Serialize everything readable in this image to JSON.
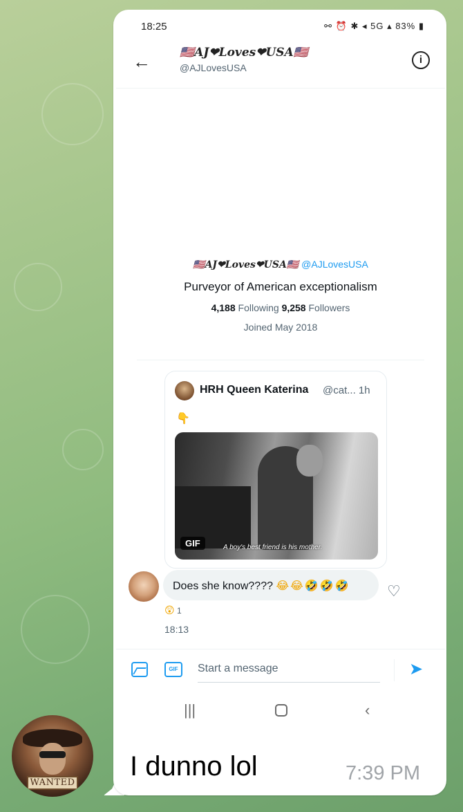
{
  "status_bar": {
    "time": "18:25",
    "icons": "⚯ ⏰ ✱ ◂ 5G ▴ 83% ▮",
    "battery": "83%"
  },
  "header": {
    "display_name": "🇺🇸AJ❤Loves❤USA🇺🇸",
    "handle": "@AJLovesUSA"
  },
  "profile": {
    "display_name": "🇺🇸AJ❤Loves❤USA🇺🇸",
    "handle": "@AJLovesUSA",
    "bio": "Purveyor of American exceptionalism",
    "following_count": "4,188",
    "following_label": "Following",
    "followers_count": "9,258",
    "followers_label": "Followers",
    "joined": "Joined May 2018"
  },
  "shared_tweet": {
    "author_name": "HRH Queen Katerina",
    "meta": "@cat... 1h",
    "text": "👇",
    "gif_badge": "GIF",
    "gif_caption": "A boy's best friend is his mother."
  },
  "message": {
    "text": "Does she know????",
    "emojis": "😂😂🤣🤣🤣",
    "reaction_emoji": "😲",
    "reaction_count": "1",
    "time": "18:13"
  },
  "composer": {
    "placeholder": "Start a message",
    "gif_label": "GIF"
  },
  "navbar": {
    "recents": "|||",
    "back": "‹"
  },
  "telegram": {
    "message_text": "I dunno lol",
    "time": "7:39 PM",
    "avatar_label": "WANTED"
  },
  "colors": {
    "accent": "#1d9bf0",
    "bubble": "#ffffff"
  }
}
